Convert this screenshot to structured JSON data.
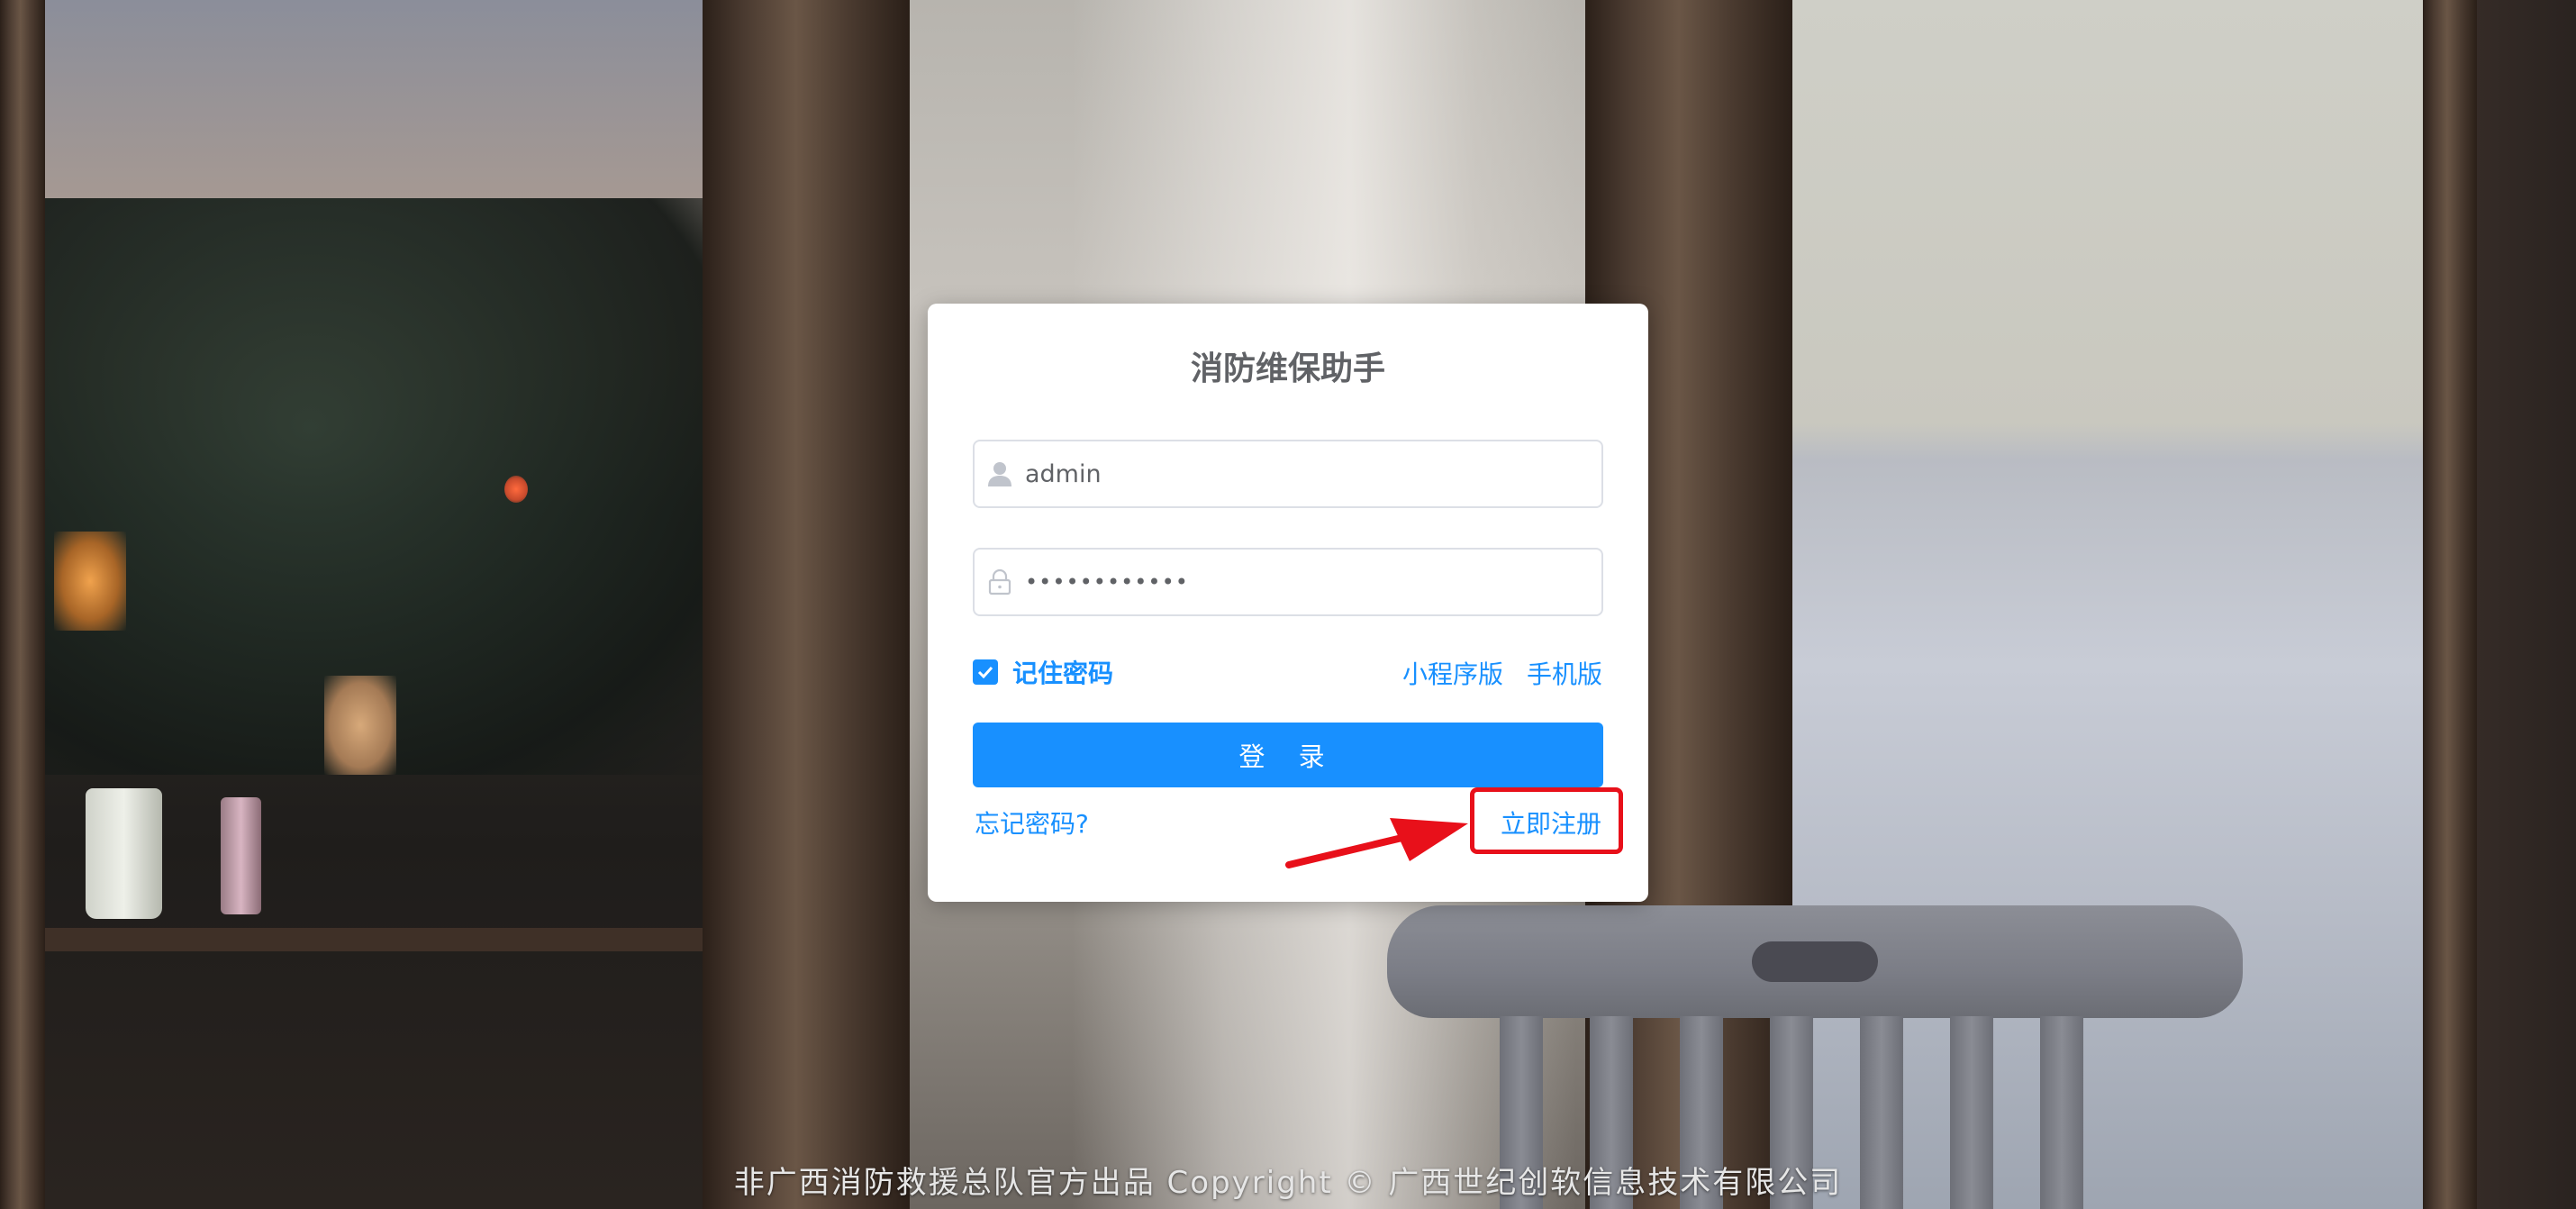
{
  "app": {
    "title": "消防维保助手"
  },
  "login_form": {
    "username": {
      "value": "admin",
      "icon": "user-icon"
    },
    "password": {
      "value": "••••••••••••",
      "icon": "lock-icon"
    },
    "remember": {
      "label": "记住密码",
      "checked": true
    },
    "mini_program_link": "小程序版",
    "mobile_link": "手机版",
    "login_button": "登 录",
    "forgot_link": "忘记密码?",
    "register_link": "立即注册"
  },
  "annotation": {
    "highlight_color": "#e8101a",
    "target": "register_link"
  },
  "colors": {
    "primary": "#1890ff",
    "card_bg": "#ffffff",
    "title_text": "#606266"
  },
  "footer": {
    "text": "非广西消防救援总队官方出品 Copyright © 广西世纪创软信息技术有限公司"
  }
}
